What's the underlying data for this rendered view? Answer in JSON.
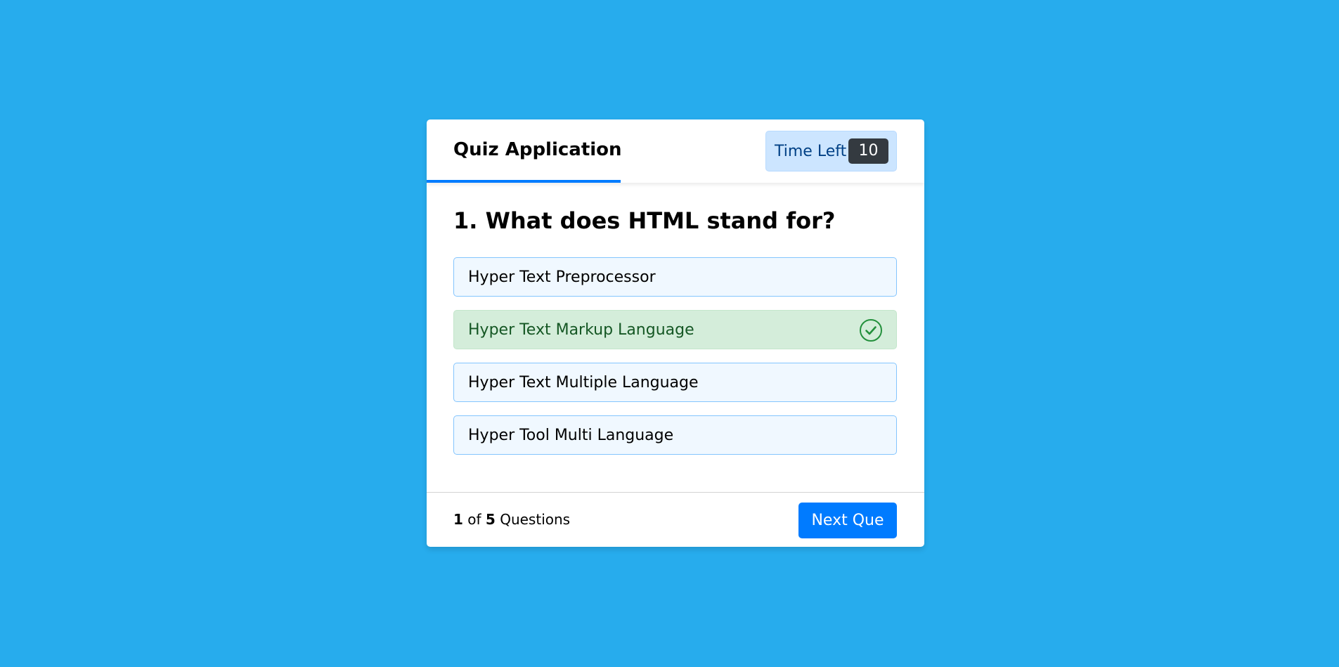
{
  "header": {
    "title": "Quiz Application",
    "timer_label": "Time Left",
    "timer_value": "10",
    "progress_fraction": 0.39
  },
  "question": {
    "text": "1. What does HTML stand for?"
  },
  "options": [
    {
      "label": "Hyper Text Preprocessor",
      "state": "default"
    },
    {
      "label": "Hyper Text Markup Language",
      "state": "correct"
    },
    {
      "label": "Hyper Text Multiple Language",
      "state": "default"
    },
    {
      "label": "Hyper Tool Multi Language",
      "state": "default"
    }
  ],
  "footer": {
    "current": "1",
    "of_text": "of",
    "total": "5",
    "suffix": "Questions",
    "next_label": "Next Que"
  },
  "colors": {
    "background": "#27aced",
    "accent": "#007bff",
    "correct_bg": "#d4edda",
    "correct_text": "#155724",
    "correct_icon": "#23903c"
  },
  "icons": {
    "correct": "check-circle-icon"
  }
}
